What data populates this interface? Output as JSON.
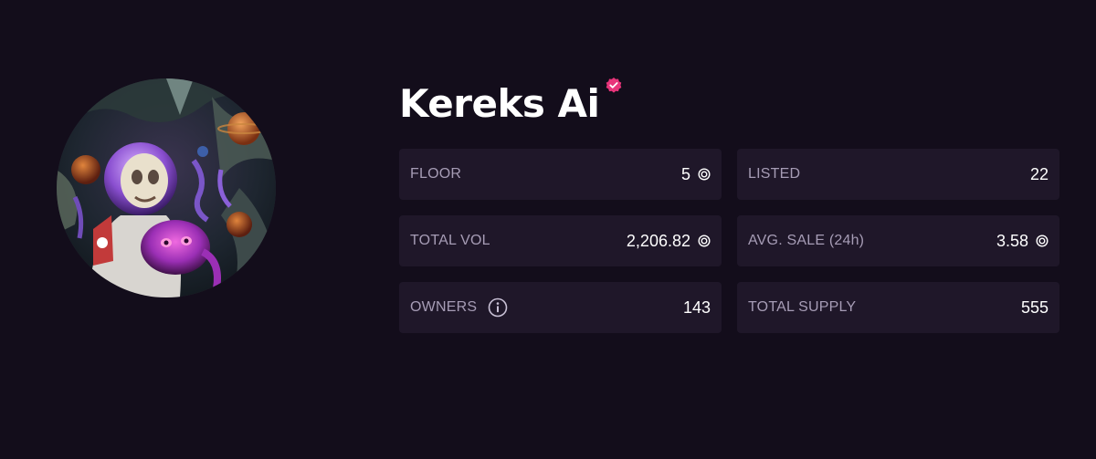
{
  "collection": {
    "name": "Kereks Ai",
    "verified": true,
    "avatar_icon": "collection-avatar",
    "accent_color": "#e8347a"
  },
  "stats": [
    {
      "label": "FLOOR",
      "value": "5",
      "currency_icon": "sol-icon"
    },
    {
      "label": "LISTED",
      "value": "22"
    },
    {
      "label": "TOTAL VOL",
      "value": "2,206.82",
      "currency_icon": "sol-icon"
    },
    {
      "label": "AVG. SALE (24h)",
      "value": "3.58",
      "currency_icon": "sol-icon"
    },
    {
      "label": "OWNERS",
      "value": "143",
      "info_icon": "info-icon"
    },
    {
      "label": "TOTAL SUPPLY",
      "value": "555"
    }
  ]
}
